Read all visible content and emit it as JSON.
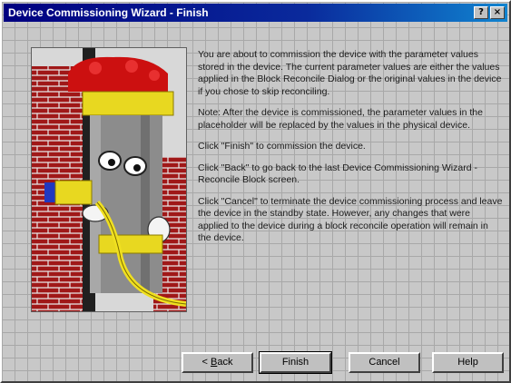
{
  "window": {
    "title": "Device Commissioning Wizard - Finish",
    "help_glyph": "?",
    "close_glyph": "×"
  },
  "paragraphs": [
    "You are about to commission the device with the parameter values stored in the device. The current parameter values are either the values applied in the Block Reconcile Dialog or the original values in the device if you chose to skip reconciling.",
    "Note: After the device is commissioned, the parameter values in the placeholder will be replaced by the values in the physical device.",
    "Click \"Finish\" to commission the device.",
    "Click \"Back\" to go back to the last Device Commissioning Wizard - Reconcile Block screen.",
    "Click \"Cancel\" to terminate the device commissioning process and leave the device in the standby state. However, any changes that were applied to the device during a block reconcile operation will remain in the device."
  ],
  "buttons": {
    "back_prefix": "< ",
    "back_mnemonic": "B",
    "back_rest": "ack",
    "finish": "Finish",
    "cancel": "Cancel",
    "help": "Help"
  },
  "colors": {
    "titlebar": "#000080",
    "brick": "#a01818",
    "device_body": "#8c8c8c",
    "cable": "#f0e020"
  }
}
